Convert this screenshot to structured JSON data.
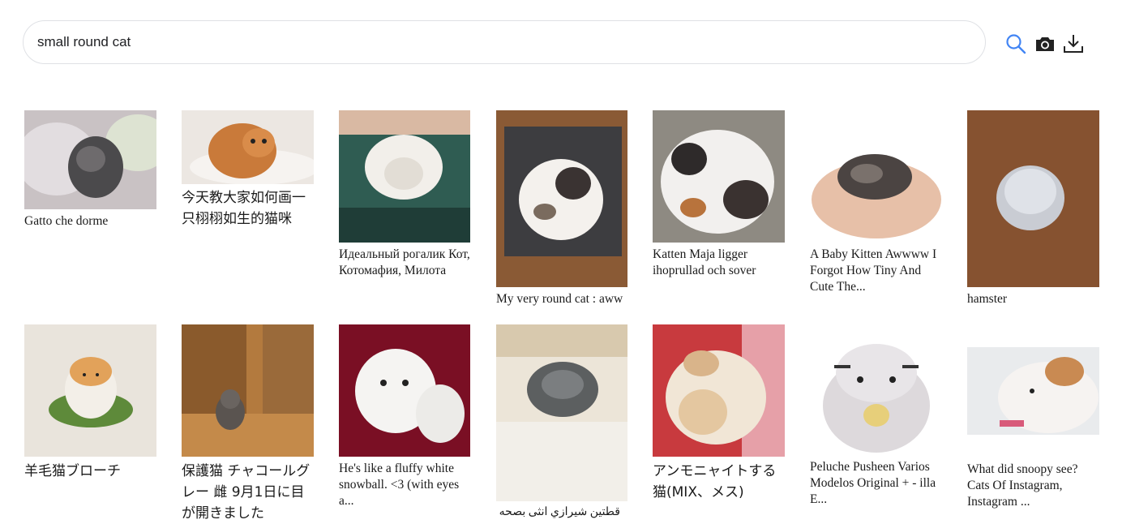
{
  "search": {
    "query": "small round cat",
    "search_icon": "search-icon",
    "camera_icon": "camera-icon",
    "download_icon": "download-icon",
    "accent_color": "#4285f4"
  },
  "results": [
    {
      "caption": "Gatto che dorme"
    },
    {
      "caption": "今天教大家如何画一只栩栩如生的猫咪"
    },
    {
      "caption": "Идеальный рогалик Кот, Котомафия, Милота"
    },
    {
      "caption": "My very round cat : aww"
    },
    {
      "caption": "Katten Maja ligger ihoprullad och sover"
    },
    {
      "caption": "A Baby Kitten Awwww I Forgot How Tiny And Cute The..."
    },
    {
      "caption": "hamster"
    },
    {
      "caption": "羊毛猫ブローチ"
    },
    {
      "caption": "保護猫 チャコールグレー 雌 9月1日に目が開きました"
    },
    {
      "caption": "He's like a fluffy white snowball. <3 (with eyes a..."
    },
    {
      "caption": "قطتين شيرازي انثى بصحه"
    },
    {
      "caption": "アンモニャイトする猫(MIX、メス)"
    },
    {
      "caption": "Peluche Pusheen Varios Modelos Original + - illa E..."
    },
    {
      "caption": "What did snoopy see? Cats Of Instagram, Instagram ..."
    }
  ]
}
